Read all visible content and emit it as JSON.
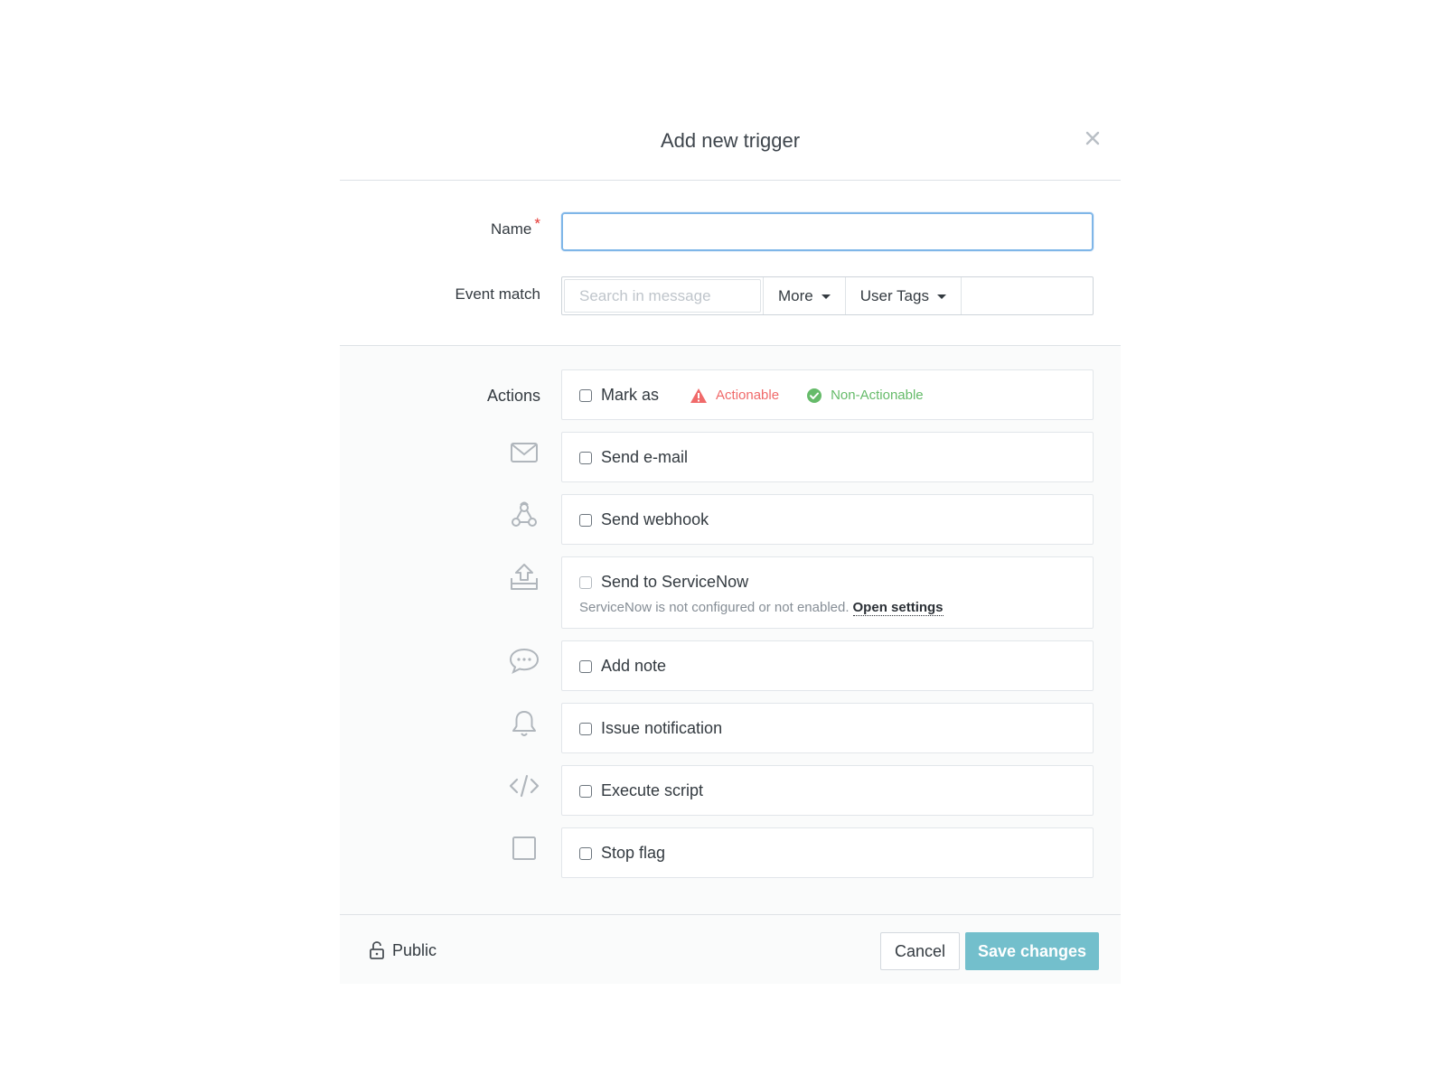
{
  "modal": {
    "title": "Add new trigger"
  },
  "form": {
    "name_label": "Name",
    "required_mark": "*",
    "name_value": "",
    "event_match_label": "Event match",
    "search_placeholder": "Search in message",
    "more_label": "More",
    "user_tags_label": "User Tags"
  },
  "actions": {
    "label": "Actions",
    "mark_as": "Mark as",
    "actionable": "Actionable",
    "non_actionable": "Non-Actionable",
    "send_email": "Send e-mail",
    "send_webhook": "Send webhook",
    "send_servicenow": "Send to ServiceNow",
    "servicenow_note": "ServiceNow is not configured or not enabled.",
    "open_settings": "Open settings",
    "add_note": "Add note",
    "issue_notification": "Issue notification",
    "execute_script": "Execute script",
    "stop_flag": "Stop flag"
  },
  "footer": {
    "public_label": "Public",
    "cancel_label": "Cancel",
    "save_label": "Save changes"
  },
  "colors": {
    "actionable": "#f06a6a",
    "non_actionable": "#66bb6a",
    "save_button": "#73bfcc",
    "focus_border": "#7fb6e8"
  },
  "icons": {
    "close": "close-icon",
    "email": "envelope-icon",
    "webhook": "webhook-icon",
    "servicenow": "upload-tray-icon",
    "note": "speech-bubble-icon",
    "notification": "bell-icon",
    "script": "code-icon",
    "stop_flag": "square-icon",
    "public": "unlock-icon"
  }
}
